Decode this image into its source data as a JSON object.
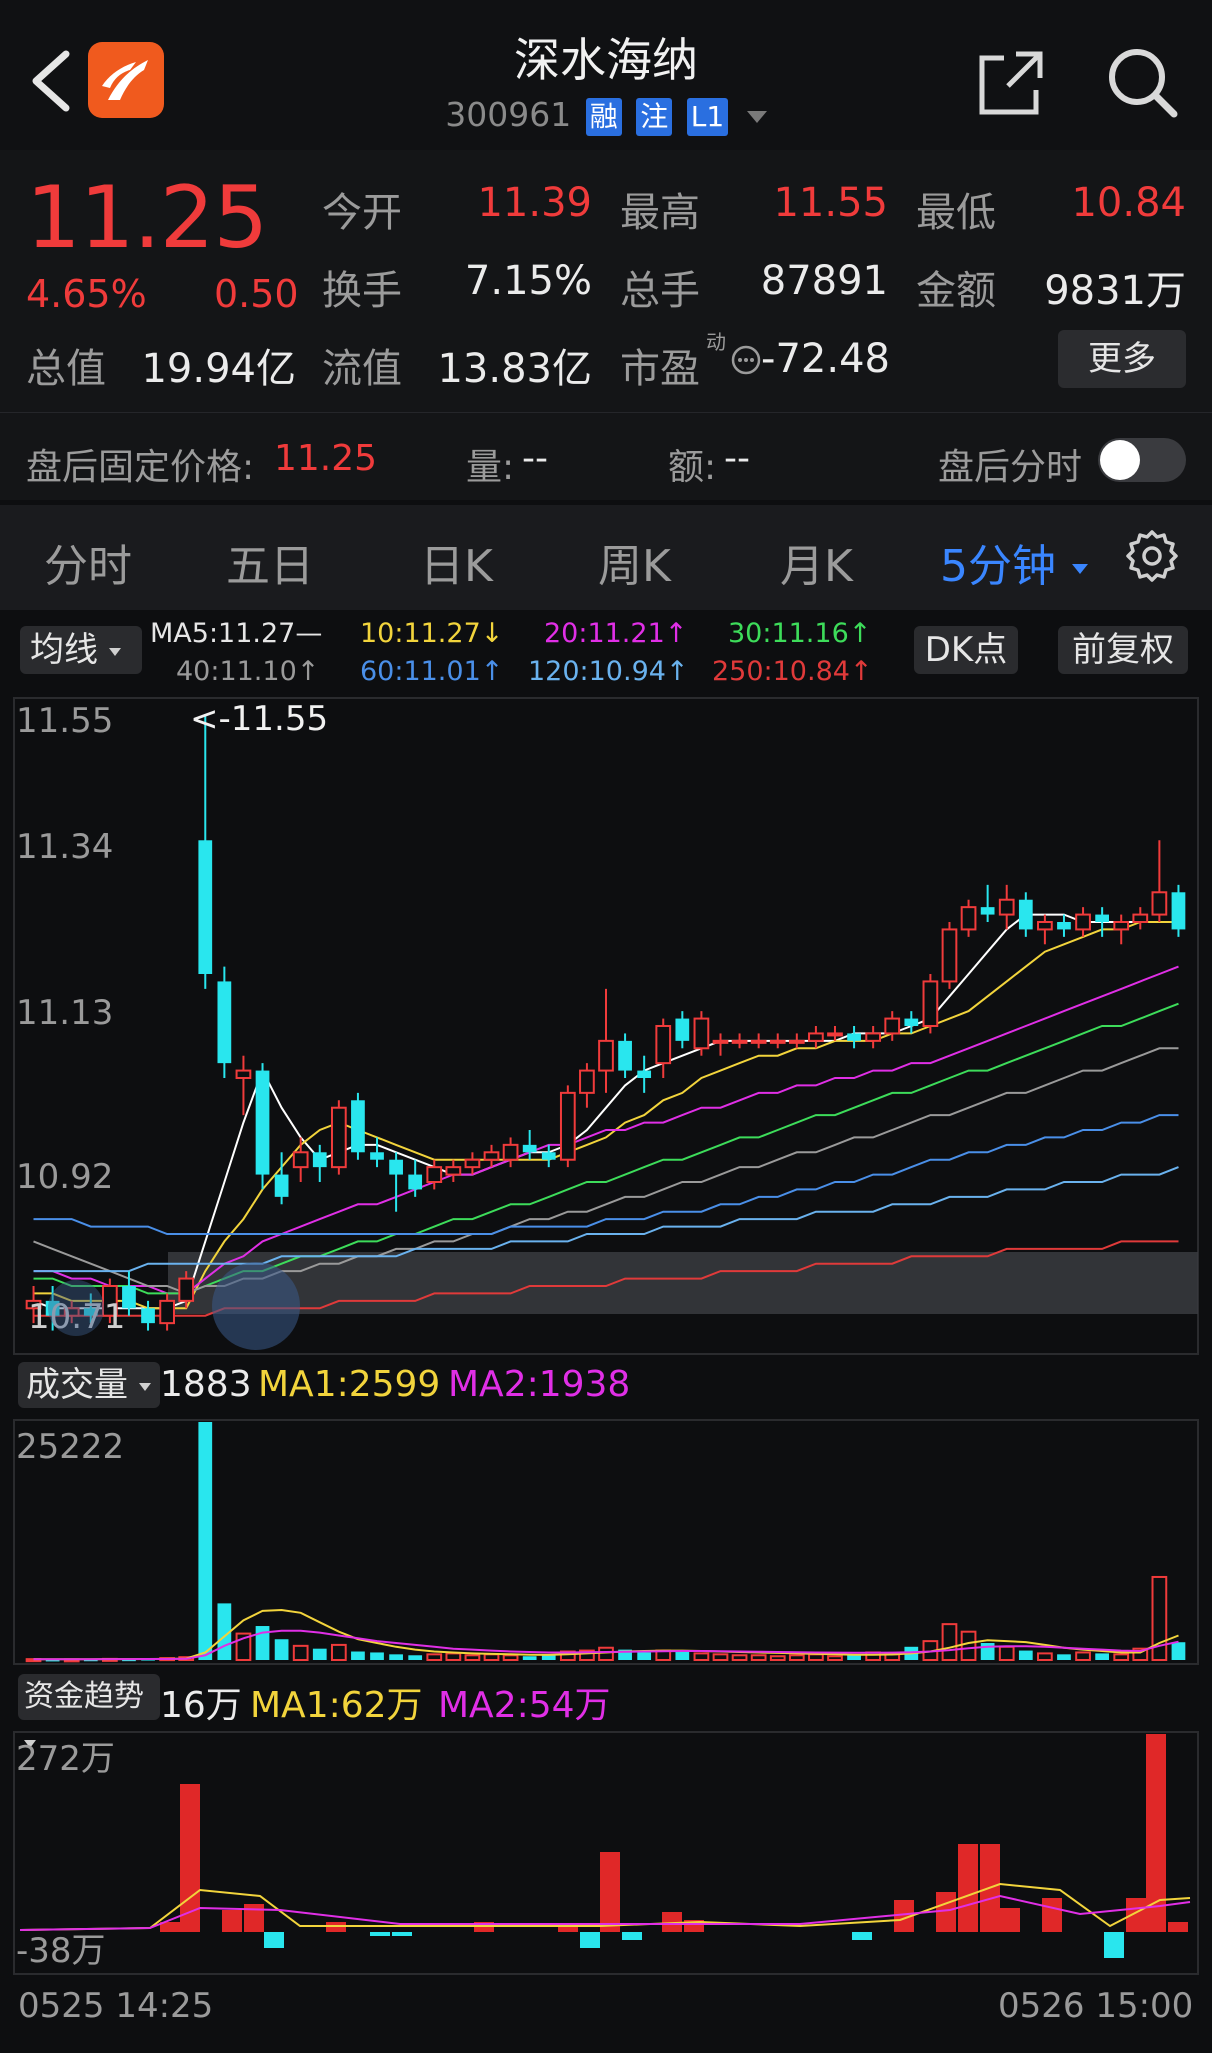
{
  "header": {
    "title": "深水海纳",
    "code": "300961",
    "tags": [
      "融",
      "注",
      "L1"
    ]
  },
  "quote": {
    "price": "11.25",
    "change_pct": "4.65%",
    "change": "0.50",
    "open_label": "今开",
    "open": "11.39",
    "high_label": "最高",
    "high": "11.55",
    "low_label": "最低",
    "low": "10.84",
    "turnover_label": "换手",
    "turnover": "7.15%",
    "volume_label": "总手",
    "volume": "87891",
    "amount_label": "金额",
    "amount": "9831万",
    "mcap_label": "总值",
    "mcap": "19.94亿",
    "float_label": "流值",
    "float": "13.83亿",
    "pe_label": "市盈",
    "pe_sup": "动",
    "pe": "-72.48",
    "more_label": "更多"
  },
  "after_hours": {
    "price_label": "盘后固定价格:",
    "price": "11.25",
    "vol_label": "量:",
    "vol": "--",
    "amt_label": "额:",
    "amt": "--",
    "timeshare_label": "盘后分时"
  },
  "tabs": [
    "分时",
    "五日",
    "日K",
    "周K",
    "月K",
    "5分钟"
  ],
  "ma_bar": {
    "selector": "均线",
    "items": [
      {
        "text": "MA5:11.27—",
        "color": "#e6e6e6"
      },
      {
        "text": "10:11.27↓",
        "color": "#f2d43c"
      },
      {
        "text": "20:11.21↑",
        "color": "#e02fe6"
      },
      {
        "text": "30:11.16↑",
        "color": "#3ddc5a"
      },
      {
        "text": "40:11.10↑",
        "color": "#9a9a9a"
      },
      {
        "text": "60:11.01↑",
        "color": "#4a8fe8"
      },
      {
        "text": "120:10.94↑",
        "color": "#6ab2ee"
      },
      {
        "text": "250:10.84↑",
        "color": "#e03a3a"
      }
    ],
    "dk_label": "DK点",
    "adjust_label": "前复权"
  },
  "price_chart": {
    "y_ticks": [
      "11.55",
      "11.34",
      "11.13",
      "10.92"
    ],
    "bottom_label": "10.71",
    "max_marker": "<-11.55"
  },
  "volume_panel": {
    "selector": "成交量",
    "value": "1883",
    "ma1": "MA1:2599",
    "ma2": "MA2:1938",
    "y_top": "25222"
  },
  "money_panel": {
    "selector": "资金趋势",
    "value": "16万",
    "ma1": "MA1:62万",
    "ma2": "MA2:54万",
    "y_top": "272万",
    "y_bottom": "-38万"
  },
  "time_axis": {
    "start": "0525 14:25",
    "end": "0526 15:00"
  },
  "colors": {
    "up": "#f03b3b",
    "down": "#29e6ee",
    "accent": "#3a86ff"
  },
  "chart_data": {
    "type": "candlestick",
    "y_range": [
      10.71,
      11.55
    ],
    "candles": [
      {
        "o": 10.75,
        "h": 10.78,
        "l": 10.73,
        "c": 10.76
      },
      {
        "o": 10.76,
        "h": 10.78,
        "l": 10.72,
        "c": 10.74
      },
      {
        "o": 10.74,
        "h": 10.76,
        "l": 10.73,
        "c": 10.75
      },
      {
        "o": 10.75,
        "h": 10.77,
        "l": 10.73,
        "c": 10.74
      },
      {
        "o": 10.74,
        "h": 10.79,
        "l": 10.73,
        "c": 10.78
      },
      {
        "o": 10.78,
        "h": 10.8,
        "l": 10.74,
        "c": 10.75
      },
      {
        "o": 10.75,
        "h": 10.76,
        "l": 10.72,
        "c": 10.73
      },
      {
        "o": 10.73,
        "h": 10.77,
        "l": 10.72,
        "c": 10.76
      },
      {
        "o": 10.76,
        "h": 10.8,
        "l": 10.75,
        "c": 10.79
      },
      {
        "o": 11.38,
        "h": 11.55,
        "l": 11.18,
        "c": 11.2
      },
      {
        "o": 11.19,
        "h": 11.21,
        "l": 11.06,
        "c": 11.08
      },
      {
        "o": 11.06,
        "h": 11.09,
        "l": 11.01,
        "c": 11.07
      },
      {
        "o": 11.07,
        "h": 11.08,
        "l": 10.91,
        "c": 10.93
      },
      {
        "o": 10.93,
        "h": 10.96,
        "l": 10.89,
        "c": 10.9
      },
      {
        "o": 10.94,
        "h": 10.98,
        "l": 10.92,
        "c": 10.96
      },
      {
        "o": 10.96,
        "h": 10.97,
        "l": 10.92,
        "c": 10.94
      },
      {
        "o": 10.94,
        "h": 11.03,
        "l": 10.93,
        "c": 11.02
      },
      {
        "o": 11.03,
        "h": 11.04,
        "l": 10.95,
        "c": 10.96
      },
      {
        "o": 10.96,
        "h": 10.98,
        "l": 10.94,
        "c": 10.95
      },
      {
        "o": 10.95,
        "h": 10.96,
        "l": 10.88,
        "c": 10.93
      },
      {
        "o": 10.93,
        "h": 10.95,
        "l": 10.9,
        "c": 10.91
      },
      {
        "o": 10.92,
        "h": 10.95,
        "l": 10.91,
        "c": 10.94
      },
      {
        "o": 10.93,
        "h": 10.95,
        "l": 10.92,
        "c": 10.94
      },
      {
        "o": 10.94,
        "h": 10.96,
        "l": 10.93,
        "c": 10.95
      },
      {
        "o": 10.95,
        "h": 10.97,
        "l": 10.94,
        "c": 10.96
      },
      {
        "o": 10.95,
        "h": 10.98,
        "l": 10.94,
        "c": 10.97
      },
      {
        "o": 10.97,
        "h": 10.99,
        "l": 10.95,
        "c": 10.96
      },
      {
        "o": 10.96,
        "h": 10.97,
        "l": 10.94,
        "c": 10.95
      },
      {
        "o": 10.95,
        "h": 11.05,
        "l": 10.94,
        "c": 11.04
      },
      {
        "o": 11.04,
        "h": 11.08,
        "l": 11.02,
        "c": 11.07
      },
      {
        "o": 11.07,
        "h": 11.18,
        "l": 11.04,
        "c": 11.11
      },
      {
        "o": 11.11,
        "h": 11.12,
        "l": 11.06,
        "c": 11.07
      },
      {
        "o": 11.07,
        "h": 11.09,
        "l": 11.04,
        "c": 11.06
      },
      {
        "o": 11.08,
        "h": 11.14,
        "l": 11.06,
        "c": 11.13
      },
      {
        "o": 11.14,
        "h": 11.15,
        "l": 11.1,
        "c": 11.11
      },
      {
        "o": 11.1,
        "h": 11.15,
        "l": 11.09,
        "c": 11.14
      },
      {
        "o": 11.11,
        "h": 11.12,
        "l": 11.09,
        "c": 11.11
      },
      {
        "o": 11.11,
        "h": 11.12,
        "l": 11.1,
        "c": 11.11
      },
      {
        "o": 11.11,
        "h": 11.12,
        "l": 11.1,
        "c": 11.11
      },
      {
        "o": 11.11,
        "h": 11.12,
        "l": 11.1,
        "c": 11.11
      },
      {
        "o": 11.11,
        "h": 11.12,
        "l": 11.1,
        "c": 11.11
      },
      {
        "o": 11.11,
        "h": 11.13,
        "l": 11.1,
        "c": 11.12
      },
      {
        "o": 11.12,
        "h": 11.13,
        "l": 11.11,
        "c": 11.12
      },
      {
        "o": 11.12,
        "h": 11.13,
        "l": 11.1,
        "c": 11.11
      },
      {
        "o": 11.11,
        "h": 11.13,
        "l": 11.1,
        "c": 11.12
      },
      {
        "o": 11.12,
        "h": 11.15,
        "l": 11.11,
        "c": 11.14
      },
      {
        "o": 11.14,
        "h": 11.15,
        "l": 11.12,
        "c": 11.13
      },
      {
        "o": 11.13,
        "h": 11.2,
        "l": 11.12,
        "c": 11.19
      },
      {
        "o": 11.19,
        "h": 11.27,
        "l": 11.18,
        "c": 11.26
      },
      {
        "o": 11.26,
        "h": 11.3,
        "l": 11.25,
        "c": 11.29
      },
      {
        "o": 11.29,
        "h": 11.32,
        "l": 11.27,
        "c": 11.28
      },
      {
        "o": 11.28,
        "h": 11.32,
        "l": 11.26,
        "c": 11.3
      },
      {
        "o": 11.3,
        "h": 11.31,
        "l": 11.25,
        "c": 11.26
      },
      {
        "o": 11.26,
        "h": 11.28,
        "l": 11.24,
        "c": 11.27
      },
      {
        "o": 11.27,
        "h": 11.28,
        "l": 11.25,
        "c": 11.26
      },
      {
        "o": 11.26,
        "h": 11.29,
        "l": 11.25,
        "c": 11.28
      },
      {
        "o": 11.28,
        "h": 11.29,
        "l": 11.25,
        "c": 11.27
      },
      {
        "o": 11.26,
        "h": 11.28,
        "l": 11.24,
        "c": 11.27
      },
      {
        "o": 11.27,
        "h": 11.29,
        "l": 11.26,
        "c": 11.28
      },
      {
        "o": 11.28,
        "h": 11.38,
        "l": 11.27,
        "c": 11.31
      },
      {
        "o": 11.31,
        "h": 11.32,
        "l": 11.25,
        "c": 11.26
      }
    ],
    "ma": {
      "MA5": [
        10.76,
        10.75,
        10.75,
        10.75,
        10.75,
        10.75,
        10.75,
        10.75,
        10.76,
        10.84,
        10.92,
        11.0,
        11.07,
        11.02,
        10.98,
        10.95,
        10.96,
        10.97,
        10.97,
        10.96,
        10.95,
        10.94,
        10.93,
        10.93,
        10.94,
        10.95,
        10.96,
        10.96,
        10.97,
        10.99,
        11.02,
        11.05,
        11.07,
        11.08,
        11.09,
        11.1,
        11.11,
        11.11,
        11.11,
        11.11,
        11.11,
        11.11,
        11.11,
        11.12,
        11.12,
        11.12,
        11.13,
        11.14,
        11.17,
        11.2,
        11.23,
        11.26,
        11.28,
        11.28,
        11.28,
        11.27,
        11.27,
        11.27,
        11.27,
        11.27,
        11.27
      ],
      "MA10": [
        10.77,
        10.77,
        10.76,
        10.76,
        10.76,
        10.76,
        10.75,
        10.75,
        10.75,
        10.8,
        10.84,
        10.87,
        10.91,
        10.94,
        10.97,
        10.99,
        11.0,
        10.99,
        10.98,
        10.97,
        10.96,
        10.95,
        10.95,
        10.95,
        10.95,
        10.95,
        10.95,
        10.95,
        10.96,
        10.97,
        10.98,
        11.0,
        11.01,
        11.03,
        11.04,
        11.06,
        11.07,
        11.08,
        11.09,
        11.09,
        11.1,
        11.1,
        11.11,
        11.11,
        11.11,
        11.12,
        11.12,
        11.13,
        11.14,
        11.15,
        11.17,
        11.19,
        11.21,
        11.23,
        11.24,
        11.25,
        11.26,
        11.26,
        11.27,
        11.27,
        11.27
      ],
      "MA20": [
        10.8,
        10.8,
        10.79,
        10.79,
        10.78,
        10.78,
        10.78,
        10.77,
        10.77,
        10.79,
        10.81,
        10.82,
        10.84,
        10.85,
        10.86,
        10.87,
        10.88,
        10.89,
        10.89,
        10.9,
        10.91,
        10.92,
        10.93,
        10.93,
        10.94,
        10.95,
        10.96,
        10.97,
        10.97,
        10.98,
        10.99,
        10.99,
        11.0,
        11.0,
        11.01,
        11.02,
        11.02,
        11.03,
        11.04,
        11.04,
        11.05,
        11.05,
        11.06,
        11.06,
        11.07,
        11.07,
        11.08,
        11.08,
        11.09,
        11.1,
        11.11,
        11.12,
        11.13,
        11.14,
        11.15,
        11.16,
        11.17,
        11.18,
        11.19,
        11.2,
        11.21
      ],
      "MA30": [
        10.79,
        10.79,
        10.78,
        10.78,
        10.78,
        10.78,
        10.77,
        10.77,
        10.77,
        10.78,
        10.79,
        10.8,
        10.8,
        10.81,
        10.82,
        10.82,
        10.83,
        10.84,
        10.84,
        10.85,
        10.85,
        10.86,
        10.87,
        10.87,
        10.88,
        10.89,
        10.89,
        10.9,
        10.91,
        10.92,
        10.92,
        10.93,
        10.94,
        10.95,
        10.95,
        10.96,
        10.97,
        10.98,
        10.98,
        10.99,
        11.0,
        11.01,
        11.01,
        11.02,
        11.03,
        11.04,
        11.04,
        11.05,
        11.06,
        11.07,
        11.07,
        11.08,
        11.09,
        11.1,
        11.11,
        11.12,
        11.13,
        11.13,
        11.14,
        11.15,
        11.16
      ],
      "MA40": [
        10.84,
        10.83,
        10.82,
        10.81,
        10.8,
        10.79,
        10.78,
        10.78,
        10.77,
        10.78,
        10.78,
        10.79,
        10.79,
        10.8,
        10.8,
        10.81,
        10.81,
        10.82,
        10.82,
        10.83,
        10.83,
        10.84,
        10.84,
        10.85,
        10.85,
        10.86,
        10.87,
        10.87,
        10.88,
        10.88,
        10.89,
        10.9,
        10.9,
        10.91,
        10.92,
        10.92,
        10.93,
        10.94,
        10.94,
        10.95,
        10.96,
        10.96,
        10.97,
        10.98,
        10.98,
        10.99,
        11.0,
        11.01,
        11.01,
        11.02,
        11.03,
        11.04,
        11.04,
        11.05,
        11.06,
        11.07,
        11.07,
        11.08,
        11.09,
        11.1,
        11.1
      ],
      "MA60": [
        10.87,
        10.87,
        10.87,
        10.86,
        10.86,
        10.86,
        10.86,
        10.85,
        10.85,
        10.85,
        10.85,
        10.85,
        10.85,
        10.85,
        10.85,
        10.85,
        10.85,
        10.85,
        10.85,
        10.85,
        10.85,
        10.85,
        10.85,
        10.85,
        10.85,
        10.86,
        10.86,
        10.86,
        10.86,
        10.86,
        10.87,
        10.87,
        10.87,
        10.88,
        10.88,
        10.88,
        10.89,
        10.89,
        10.9,
        10.9,
        10.91,
        10.91,
        10.92,
        10.92,
        10.93,
        10.93,
        10.94,
        10.95,
        10.95,
        10.96,
        10.96,
        10.97,
        10.97,
        10.98,
        10.98,
        10.99,
        10.99,
        11.0,
        11.0,
        11.01,
        11.01
      ],
      "MA120": [
        10.8,
        10.8,
        10.8,
        10.8,
        10.8,
        10.8,
        10.81,
        10.81,
        10.81,
        10.81,
        10.81,
        10.81,
        10.81,
        10.82,
        10.82,
        10.82,
        10.82,
        10.82,
        10.82,
        10.82,
        10.83,
        10.83,
        10.83,
        10.83,
        10.83,
        10.84,
        10.84,
        10.84,
        10.84,
        10.85,
        10.85,
        10.85,
        10.85,
        10.86,
        10.86,
        10.86,
        10.86,
        10.87,
        10.87,
        10.87,
        10.87,
        10.88,
        10.88,
        10.88,
        10.88,
        10.89,
        10.89,
        10.89,
        10.9,
        10.9,
        10.9,
        10.91,
        10.91,
        10.91,
        10.92,
        10.92,
        10.92,
        10.93,
        10.93,
        10.93,
        10.94
      ],
      "MA250": [
        10.74,
        10.74,
        10.74,
        10.74,
        10.74,
        10.74,
        10.74,
        10.74,
        10.74,
        10.74,
        10.75,
        10.75,
        10.75,
        10.75,
        10.75,
        10.75,
        10.76,
        10.76,
        10.76,
        10.76,
        10.76,
        10.77,
        10.77,
        10.77,
        10.77,
        10.77,
        10.78,
        10.78,
        10.78,
        10.78,
        10.78,
        10.79,
        10.79,
        10.79,
        10.79,
        10.79,
        10.8,
        10.8,
        10.8,
        10.8,
        10.8,
        10.81,
        10.81,
        10.81,
        10.81,
        10.81,
        10.82,
        10.82,
        10.82,
        10.82,
        10.82,
        10.83,
        10.83,
        10.83,
        10.83,
        10.83,
        10.83,
        10.84,
        10.84,
        10.84,
        10.84
      ]
    },
    "ma_colors": {
      "MA5": "#ffffff",
      "MA10": "#f2d43c",
      "MA20": "#e02fe6",
      "MA30": "#3ddc5a",
      "MA40": "#9a9a9a",
      "MA60": "#4a8fe8",
      "MA120": "#6ab2ee",
      "MA250": "#e03a3a"
    },
    "volume": [
      90,
      60,
      70,
      80,
      120,
      90,
      150,
      200,
      300,
      25222,
      6000,
      2800,
      3600,
      2200,
      1500,
      1200,
      1600,
      900,
      800,
      600,
      500,
      600,
      700,
      500,
      600,
      500,
      400,
      500,
      900,
      1000,
      1300,
      1100,
      800,
      1000,
      900,
      700,
      600,
      500,
      500,
      400,
      500,
      600,
      400,
      500,
      800,
      600,
      1400,
      2000,
      3800,
      3000,
      1800,
      1400,
      1000,
      700,
      600,
      800,
      700,
      600,
      1200,
      8800,
      1883
    ],
    "volume_ma1": [
      80,
      80,
      85,
      90,
      95,
      100,
      110,
      120,
      150,
      800,
      2500,
      4200,
      5200,
      5300,
      5000,
      4000,
      3000,
      2200,
      1800,
      1400,
      1100,
      900,
      800,
      700,
      650,
      600,
      560,
      540,
      600,
      700,
      800,
      900,
      950,
      1000,
      1000,
      950,
      900,
      850,
      800,
      750,
      700,
      650,
      600,
      560,
      560,
      580,
      700,
      900,
      1300,
      1800,
      2100,
      2000,
      1900,
      1600,
      1300,
      1100,
      950,
      800,
      800,
      1800,
      2599
    ],
    "volume_ma2": [
      90,
      90,
      90,
      90,
      95,
      100,
      105,
      110,
      130,
      500,
      1500,
      2300,
      2900,
      3100,
      3100,
      2900,
      2600,
      2300,
      2000,
      1800,
      1600,
      1400,
      1200,
      1100,
      1000,
      900,
      850,
      800,
      800,
      820,
      850,
      880,
      900,
      930,
      950,
      950,
      930,
      900,
      880,
      850,
      820,
      800,
      780,
      760,
      760,
      780,
      820,
      900,
      1050,
      1250,
      1400,
      1450,
      1450,
      1400,
      1300,
      1200,
      1100,
      1000,
      950,
      1500,
      1938
    ]
  }
}
